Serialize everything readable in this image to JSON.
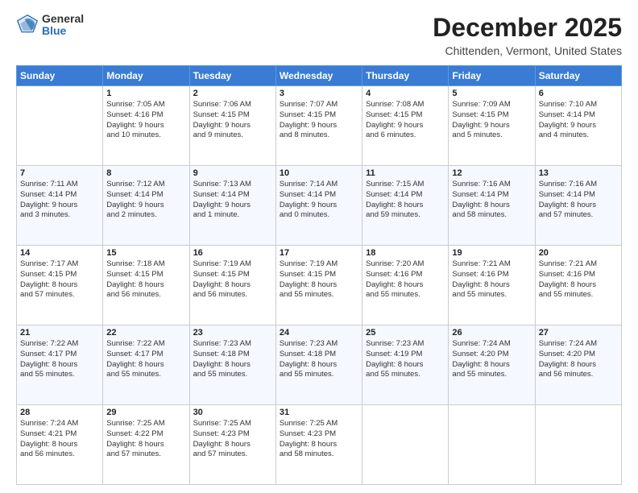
{
  "logo": {
    "general": "General",
    "blue": "Blue"
  },
  "title": "December 2025",
  "subtitle": "Chittenden, Vermont, United States",
  "days_of_week": [
    "Sunday",
    "Monday",
    "Tuesday",
    "Wednesday",
    "Thursday",
    "Friday",
    "Saturday"
  ],
  "weeks": [
    [
      {
        "day": "",
        "info": ""
      },
      {
        "day": "1",
        "info": "Sunrise: 7:05 AM\nSunset: 4:16 PM\nDaylight: 9 hours\nand 10 minutes."
      },
      {
        "day": "2",
        "info": "Sunrise: 7:06 AM\nSunset: 4:15 PM\nDaylight: 9 hours\nand 9 minutes."
      },
      {
        "day": "3",
        "info": "Sunrise: 7:07 AM\nSunset: 4:15 PM\nDaylight: 9 hours\nand 8 minutes."
      },
      {
        "day": "4",
        "info": "Sunrise: 7:08 AM\nSunset: 4:15 PM\nDaylight: 9 hours\nand 6 minutes."
      },
      {
        "day": "5",
        "info": "Sunrise: 7:09 AM\nSunset: 4:15 PM\nDaylight: 9 hours\nand 5 minutes."
      },
      {
        "day": "6",
        "info": "Sunrise: 7:10 AM\nSunset: 4:14 PM\nDaylight: 9 hours\nand 4 minutes."
      }
    ],
    [
      {
        "day": "7",
        "info": "Sunrise: 7:11 AM\nSunset: 4:14 PM\nDaylight: 9 hours\nand 3 minutes."
      },
      {
        "day": "8",
        "info": "Sunrise: 7:12 AM\nSunset: 4:14 PM\nDaylight: 9 hours\nand 2 minutes."
      },
      {
        "day": "9",
        "info": "Sunrise: 7:13 AM\nSunset: 4:14 PM\nDaylight: 9 hours\nand 1 minute."
      },
      {
        "day": "10",
        "info": "Sunrise: 7:14 AM\nSunset: 4:14 PM\nDaylight: 9 hours\nand 0 minutes."
      },
      {
        "day": "11",
        "info": "Sunrise: 7:15 AM\nSunset: 4:14 PM\nDaylight: 8 hours\nand 59 minutes."
      },
      {
        "day": "12",
        "info": "Sunrise: 7:16 AM\nSunset: 4:14 PM\nDaylight: 8 hours\nand 58 minutes."
      },
      {
        "day": "13",
        "info": "Sunrise: 7:16 AM\nSunset: 4:14 PM\nDaylight: 8 hours\nand 57 minutes."
      }
    ],
    [
      {
        "day": "14",
        "info": "Sunrise: 7:17 AM\nSunset: 4:15 PM\nDaylight: 8 hours\nand 57 minutes."
      },
      {
        "day": "15",
        "info": "Sunrise: 7:18 AM\nSunset: 4:15 PM\nDaylight: 8 hours\nand 56 minutes."
      },
      {
        "day": "16",
        "info": "Sunrise: 7:19 AM\nSunset: 4:15 PM\nDaylight: 8 hours\nand 56 minutes."
      },
      {
        "day": "17",
        "info": "Sunrise: 7:19 AM\nSunset: 4:15 PM\nDaylight: 8 hours\nand 55 minutes."
      },
      {
        "day": "18",
        "info": "Sunrise: 7:20 AM\nSunset: 4:16 PM\nDaylight: 8 hours\nand 55 minutes."
      },
      {
        "day": "19",
        "info": "Sunrise: 7:21 AM\nSunset: 4:16 PM\nDaylight: 8 hours\nand 55 minutes."
      },
      {
        "day": "20",
        "info": "Sunrise: 7:21 AM\nSunset: 4:16 PM\nDaylight: 8 hours\nand 55 minutes."
      }
    ],
    [
      {
        "day": "21",
        "info": "Sunrise: 7:22 AM\nSunset: 4:17 PM\nDaylight: 8 hours\nand 55 minutes."
      },
      {
        "day": "22",
        "info": "Sunrise: 7:22 AM\nSunset: 4:17 PM\nDaylight: 8 hours\nand 55 minutes."
      },
      {
        "day": "23",
        "info": "Sunrise: 7:23 AM\nSunset: 4:18 PM\nDaylight: 8 hours\nand 55 minutes."
      },
      {
        "day": "24",
        "info": "Sunrise: 7:23 AM\nSunset: 4:18 PM\nDaylight: 8 hours\nand 55 minutes."
      },
      {
        "day": "25",
        "info": "Sunrise: 7:23 AM\nSunset: 4:19 PM\nDaylight: 8 hours\nand 55 minutes."
      },
      {
        "day": "26",
        "info": "Sunrise: 7:24 AM\nSunset: 4:20 PM\nDaylight: 8 hours\nand 55 minutes."
      },
      {
        "day": "27",
        "info": "Sunrise: 7:24 AM\nSunset: 4:20 PM\nDaylight: 8 hours\nand 56 minutes."
      }
    ],
    [
      {
        "day": "28",
        "info": "Sunrise: 7:24 AM\nSunset: 4:21 PM\nDaylight: 8 hours\nand 56 minutes."
      },
      {
        "day": "29",
        "info": "Sunrise: 7:25 AM\nSunset: 4:22 PM\nDaylight: 8 hours\nand 57 minutes."
      },
      {
        "day": "30",
        "info": "Sunrise: 7:25 AM\nSunset: 4:23 PM\nDaylight: 8 hours\nand 57 minutes."
      },
      {
        "day": "31",
        "info": "Sunrise: 7:25 AM\nSunset: 4:23 PM\nDaylight: 8 hours\nand 58 minutes."
      },
      {
        "day": "",
        "info": ""
      },
      {
        "day": "",
        "info": ""
      },
      {
        "day": "",
        "info": ""
      }
    ]
  ]
}
